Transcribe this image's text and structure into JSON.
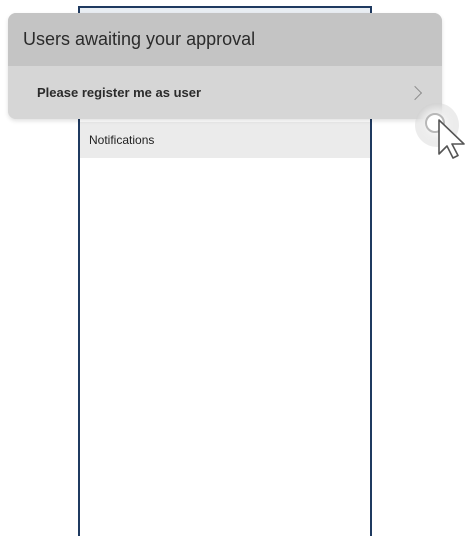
{
  "popover": {
    "title": "Users awaiting your approval",
    "items": [
      {
        "label": "Please register me as user"
      }
    ]
  },
  "app": {
    "notifications_label": "Notifications"
  },
  "icons": {
    "chevron": "chevron-right-icon",
    "cursor": "mouse-pointer-icon"
  },
  "colors": {
    "frame_border": "#1f3a60",
    "popover_header_bg": "#c4c4c4",
    "popover_item_bg": "#d6d6d6",
    "notifications_bg": "#ebebeb"
  }
}
